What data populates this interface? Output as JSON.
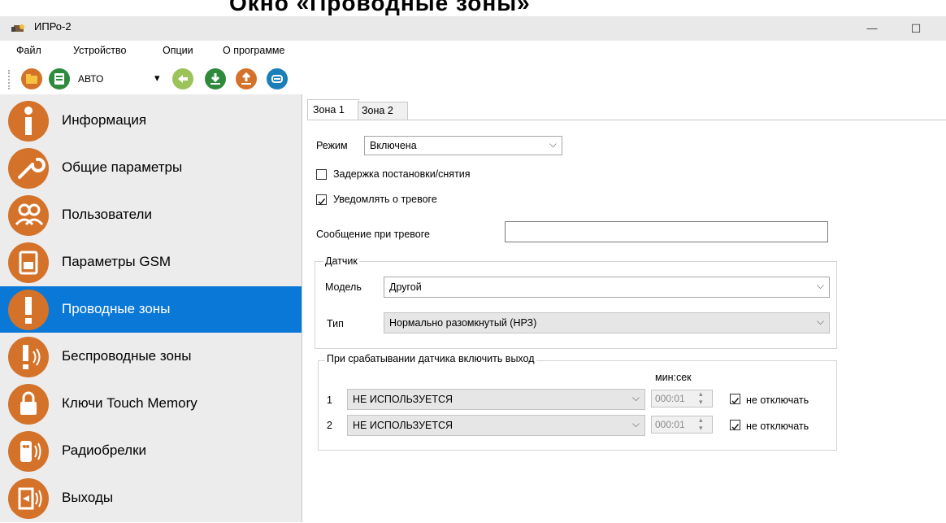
{
  "window": {
    "clipped_heading": "Окно «Проводные зоны»",
    "title": "ИПРо-2",
    "minimize_glyph": "—",
    "maximize_glyph": "☐"
  },
  "menu": [
    "Файл",
    "Устройство",
    "Опции",
    "О программе"
  ],
  "toolbar": {
    "mode_value": "АВТО",
    "mode_arrow": "▾"
  },
  "sidebar": [
    {
      "label": "Информация",
      "icon": "info-icon"
    },
    {
      "label": "Общие параметры",
      "icon": "wrench-icon"
    },
    {
      "label": "Пользователи",
      "icon": "users-icon"
    },
    {
      "label": "Параметры GSM",
      "icon": "sim-card-icon"
    },
    {
      "label": "Проводные зоны",
      "icon": "exclamation-icon"
    },
    {
      "label": "Беспроводные зоны",
      "icon": "wireless-exclamation-icon"
    },
    {
      "label": "Ключи Touch Memory",
      "icon": "lock-icon"
    },
    {
      "label": "Радиобрелки",
      "icon": "keyfob-icon"
    },
    {
      "label": "Выходы",
      "icon": "output-icon"
    }
  ],
  "active_sidebar_index": 4,
  "tabs": [
    "Зона 1",
    "Зона 2"
  ],
  "zone": {
    "mode_label": "Режим",
    "mode_value": "Включена",
    "delay_label": "Задержка постановки/снятия",
    "delay_checked": false,
    "notify_label": "Уведомлять о тревоге",
    "notify_checked": true,
    "message_label": "Сообщение при тревоге",
    "message_value": ""
  },
  "sensor": {
    "group_label": "Датчик",
    "model_label": "Модель",
    "model_value": "Другой",
    "type_label": "Тип",
    "type_value": "Нормально разомкнутый (НРЗ)"
  },
  "output": {
    "group_label": "При срабатывании датчика включить выход",
    "time_header": "мин:сек",
    "rows": [
      {
        "num": "1",
        "value": "НЕ ИСПОЛЬЗУЕТСЯ",
        "time": "000:01",
        "no_off_label": "не отключать",
        "no_off_checked": true
      },
      {
        "num": "2",
        "value": "НЕ ИСПОЛЬЗУЕТСЯ",
        "time": "000:01",
        "no_off_label": "не отключать",
        "no_off_checked": true
      }
    ]
  },
  "colors": {
    "accent": "#0a78d7",
    "icon_orange": "#d4722a",
    "sidebar_bg": "#ececec"
  }
}
